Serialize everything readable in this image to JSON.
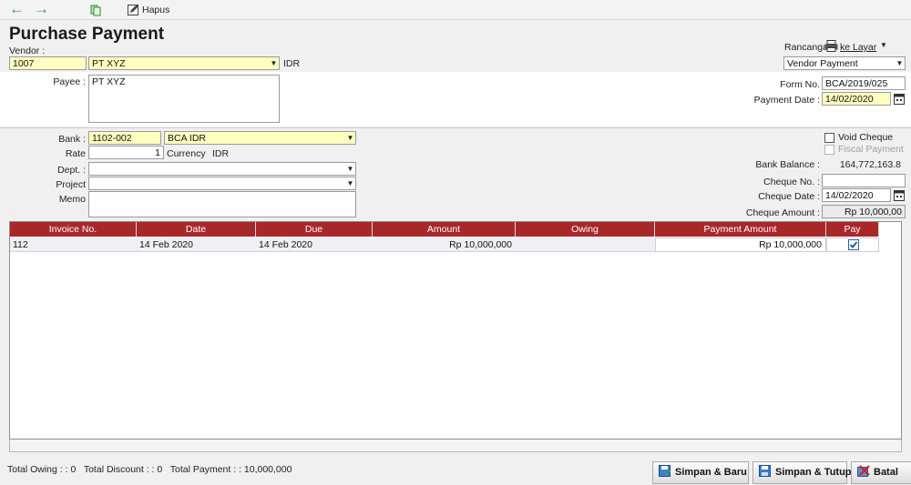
{
  "toolbar": {
    "delete_label": "Hapus",
    "icons": [
      "back-arrow-icon",
      "forward-arrow-icon",
      "copy-icon",
      "edit-icon"
    ],
    "colors": {
      "arrow": "#2ea043"
    }
  },
  "form": {
    "title": "Purchase Payment",
    "vendor_label": "Vendor :",
    "vendor_code": "1007",
    "vendor_name": "PT XYZ",
    "vendor_currency": "IDR",
    "payee_label": "Payee :",
    "payee_value": "PT XYZ",
    "design_label": "Rancanga",
    "print_label": "ke Layar",
    "template_value": "Vendor Payment",
    "form_no_label": "Form No.",
    "form_no_value": "BCA/2019/025",
    "payment_date_label": "Payment Date :",
    "payment_date_value": "14/02/2020"
  },
  "bank": {
    "bank_label": "Bank :",
    "bank_code": "1102-002",
    "bank_name": "BCA IDR",
    "rate_label": "Rate",
    "rate_value": "1",
    "currency_label": "Currency",
    "currency_value": "IDR",
    "dept_label": "Dept. :",
    "dept_value": "",
    "project_label": "Project",
    "project_value": "",
    "memo_label": "Memo",
    "memo_value": "",
    "void_cheque_label": "Void Cheque",
    "fiscal_payment_label": "Fiscal Payment",
    "bank_balance_label": "Bank Balance :",
    "bank_balance_value": "164,772,163.8",
    "cheque_no_label": "Cheque No. :",
    "cheque_no_value": "",
    "cheque_date_label": "Cheque Date :",
    "cheque_date_value": "14/02/2020",
    "cheque_amount_label": "Cheque Amount :",
    "cheque_amount_value": "Rp 10,000,00"
  },
  "grid": {
    "columns": [
      "Invoice No.",
      "Date",
      "Due",
      "Amount",
      "Owing",
      "Payment Amount",
      "Pay"
    ],
    "rows": [
      {
        "invoice_no": "112",
        "date": "14 Feb 2020",
        "due": "14 Feb 2020",
        "amount": "Rp 10,000,000",
        "owing": "",
        "payment_amount": "Rp 10,000,000",
        "pay": true
      }
    ],
    "header_color": "#a8282a"
  },
  "footer": {
    "totals": "Total Owing : : 0   Total Discount : : 0   Total Payment : : 10,000,000",
    "save_new_label": "Simpan & Baru",
    "save_close_label": "Simpan & Tutup",
    "cancel_label": "Batal"
  }
}
